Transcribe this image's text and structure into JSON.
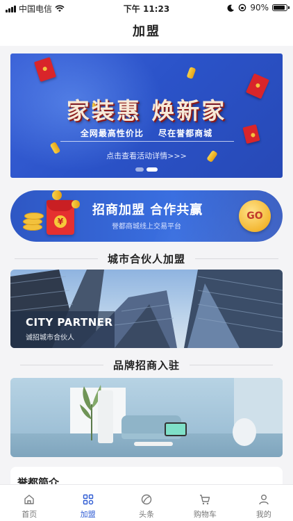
{
  "status_bar": {
    "carrier": "中国电信",
    "time": "下午 11:23",
    "battery": "90%",
    "battery_level": 0.9
  },
  "nav": {
    "title": "加盟"
  },
  "banner": {
    "title": "家装惠 焕新家",
    "sub_left": "全网最高性价比",
    "sub_right": "尽在誉都商城",
    "link": "点击查看活动详情>>>",
    "slide_count": 2,
    "active_slide": 2
  },
  "join": {
    "title": "招商加盟 合作共赢",
    "subtitle": "誉都商城线上交易平台",
    "go_label": "GO"
  },
  "sections": {
    "city": "城市合伙人加盟",
    "brand": "品牌招商入驻"
  },
  "city_card": {
    "title": "CITY PARTNER",
    "subtitle": "诚招城市合伙人"
  },
  "intro": {
    "title": "誉都简介"
  },
  "tabs": [
    {
      "label": "首页",
      "icon": "home-icon",
      "active": false
    },
    {
      "label": "加盟",
      "icon": "grid-icon",
      "active": true
    },
    {
      "label": "头条",
      "icon": "leaf-icon",
      "active": false
    },
    {
      "label": "购物车",
      "icon": "cart-icon",
      "active": false
    },
    {
      "label": "我的",
      "icon": "user-icon",
      "active": false
    }
  ],
  "colors": {
    "accent": "#2e5bd3",
    "banner_blue": "#2b53c9",
    "go_gold": "#f3b733"
  }
}
